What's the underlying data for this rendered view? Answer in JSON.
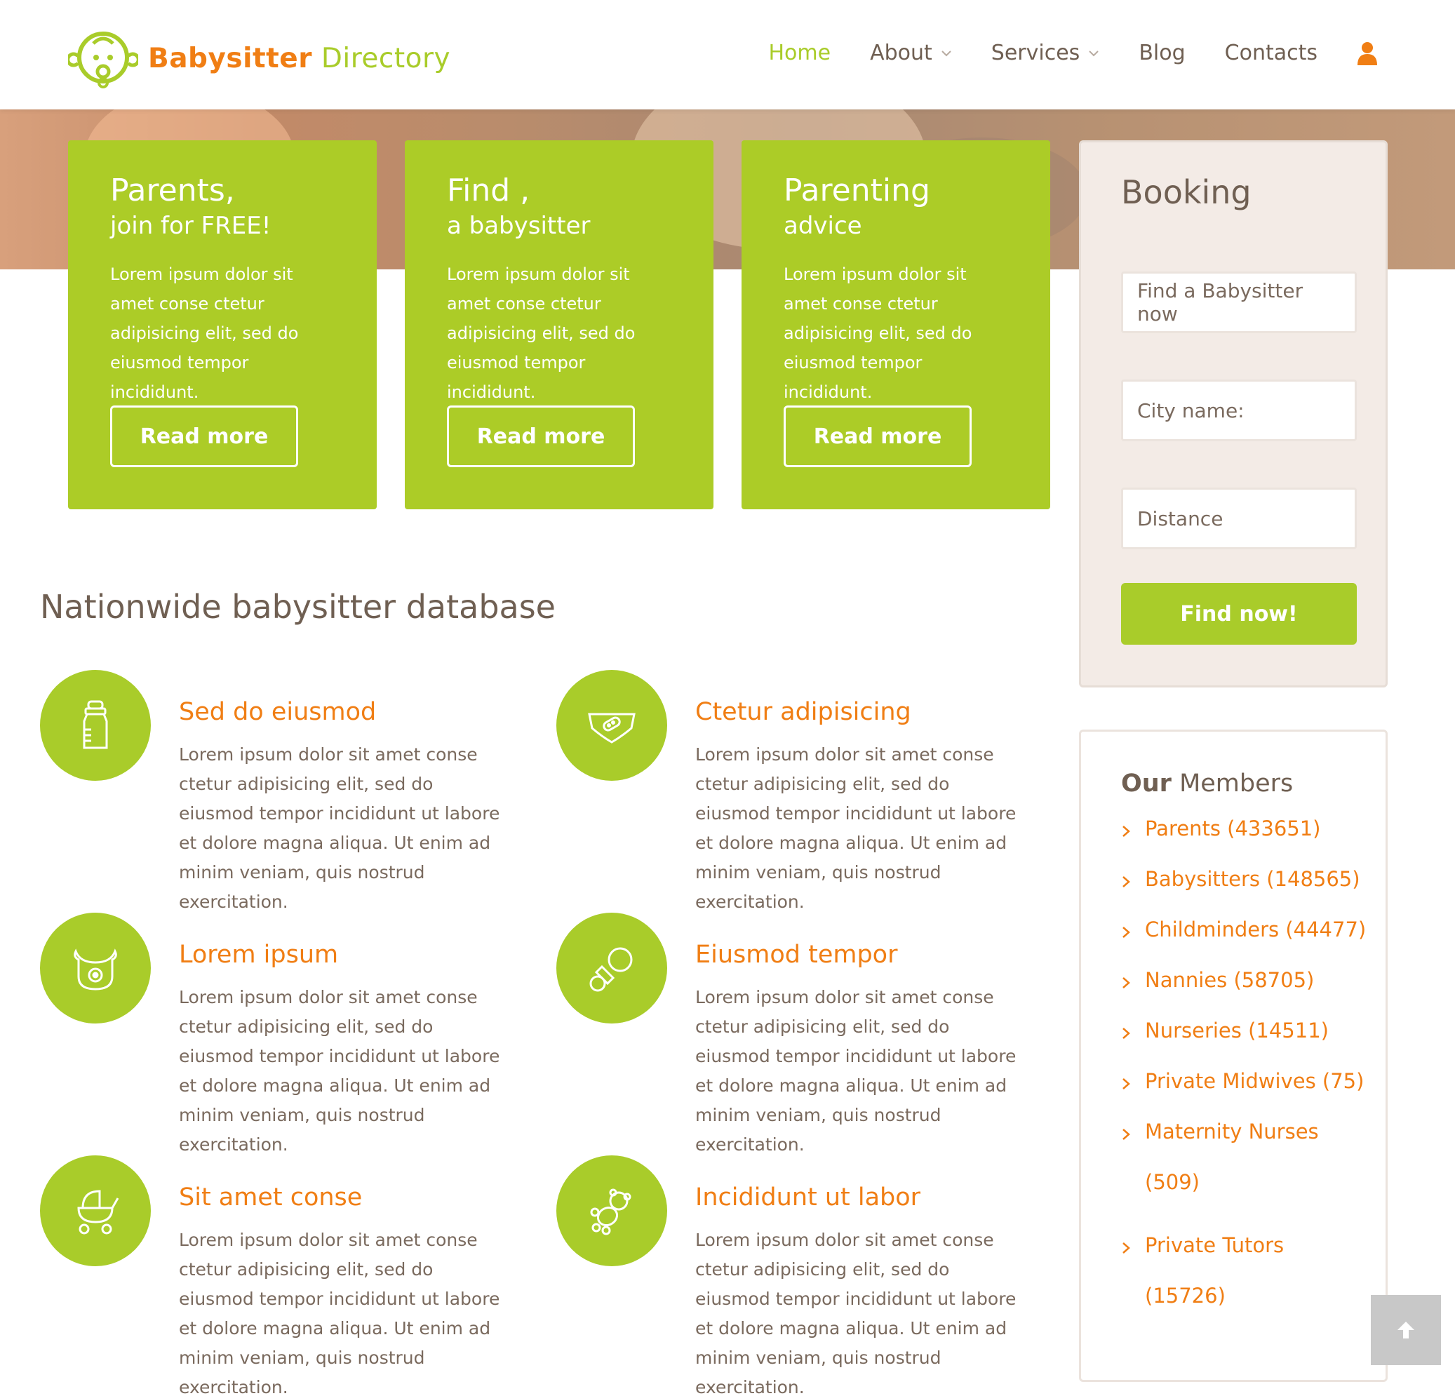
{
  "header": {
    "logo_bold": "Babysitter",
    "logo_light": " Directory",
    "nav": [
      {
        "label": "Home",
        "active": true,
        "dropdown": false
      },
      {
        "label": "About",
        "active": false,
        "dropdown": true
      },
      {
        "label": "Services",
        "active": false,
        "dropdown": true
      },
      {
        "label": "Blog",
        "active": false,
        "dropdown": false
      },
      {
        "label": "Contacts",
        "active": false,
        "dropdown": false
      }
    ],
    "user_icon": "user-icon"
  },
  "cards": [
    {
      "title": "Parents,",
      "subtitle": "join for FREE!",
      "text": "Lorem ipsum dolor sit amet conse ctetur adipisicing elit, sed do eiusmod tempor incididunt.",
      "button": "Read more"
    },
    {
      "title": "Find ,",
      "subtitle": "a babysitter",
      "text": "Lorem ipsum dolor sit amet conse ctetur adipisicing elit, sed do eiusmod tempor incididunt.",
      "button": "Read more"
    },
    {
      "title": "Parenting",
      "subtitle": "advice",
      "text": "Lorem ipsum dolor sit amet conse ctetur adipisicing elit, sed do eiusmod tempor incididunt.",
      "button": "Read more"
    }
  ],
  "booking": {
    "title": "Booking",
    "field_1": "Find a Babysitter now",
    "field_2": "City name:",
    "field_3": "Distance",
    "button": "Find now!"
  },
  "section": {
    "title": "Nationwide babysitter database",
    "features": [
      {
        "icon": "baby-bottle-icon",
        "title": "Sed do eiusmod",
        "text": "Lorem ipsum dolor sit amet conse ctetur adipisicing elit, sed do eiusmod tempor incididunt ut labore et dolore magna aliqua. Ut enim ad minim veniam, quis nostrud exercitation."
      },
      {
        "icon": "diaper-icon",
        "title": "Ctetur adipisicing",
        "text": "Lorem ipsum dolor sit amet conse ctetur adipisicing elit, sed do eiusmod tempor incididunt ut labore et dolore magna aliqua. Ut enim ad minim veniam, quis nostrud exercitation."
      },
      {
        "icon": "bib-icon",
        "title": "Lorem ipsum",
        "text": "Lorem ipsum dolor sit amet conse ctetur adipisicing elit, sed do eiusmod tempor incididunt ut labore et dolore magna aliqua. Ut enim ad minim veniam, quis nostrud exercitation."
      },
      {
        "icon": "pacifier-icon",
        "title": "Eiusmod tempor",
        "text": "Lorem ipsum dolor sit amet conse ctetur adipisicing elit, sed do eiusmod tempor incididunt ut labore et dolore magna aliqua. Ut enim ad minim veniam, quis nostrud exercitation."
      },
      {
        "icon": "stroller-icon",
        "title": "Sit amet conse",
        "text": "Lorem ipsum dolor sit amet conse ctetur adipisicing elit, sed do eiusmod tempor incididunt ut labore et dolore magna aliqua. Ut enim ad minim veniam, quis nostrud exercitation."
      },
      {
        "icon": "teddy-bear-icon",
        "title": "Incididunt ut labor",
        "text": "Lorem ipsum dolor sit amet conse ctetur adipisicing elit, sed do eiusmod tempor incididunt ut labore et dolore magna aliqua. Ut enim ad minim veniam, quis nostrud exercitation."
      }
    ]
  },
  "members": {
    "title_bold": "Our",
    "title_light": " Members",
    "items": [
      {
        "label": "Parents (433651)"
      },
      {
        "label": "Babysitters (148565)"
      },
      {
        "label": "Childminders (44477)"
      },
      {
        "label": "Nannies (58705)"
      },
      {
        "label": "Nurseries (14511)"
      },
      {
        "label": "Private Midwives (75)"
      },
      {
        "label": "Maternity Nurses (509)"
      },
      {
        "label": "Private Tutors (15726)"
      }
    ]
  },
  "colors": {
    "green": "#a9cc2a",
    "orange": "#f07e14",
    "text": "#7a6a5e"
  }
}
